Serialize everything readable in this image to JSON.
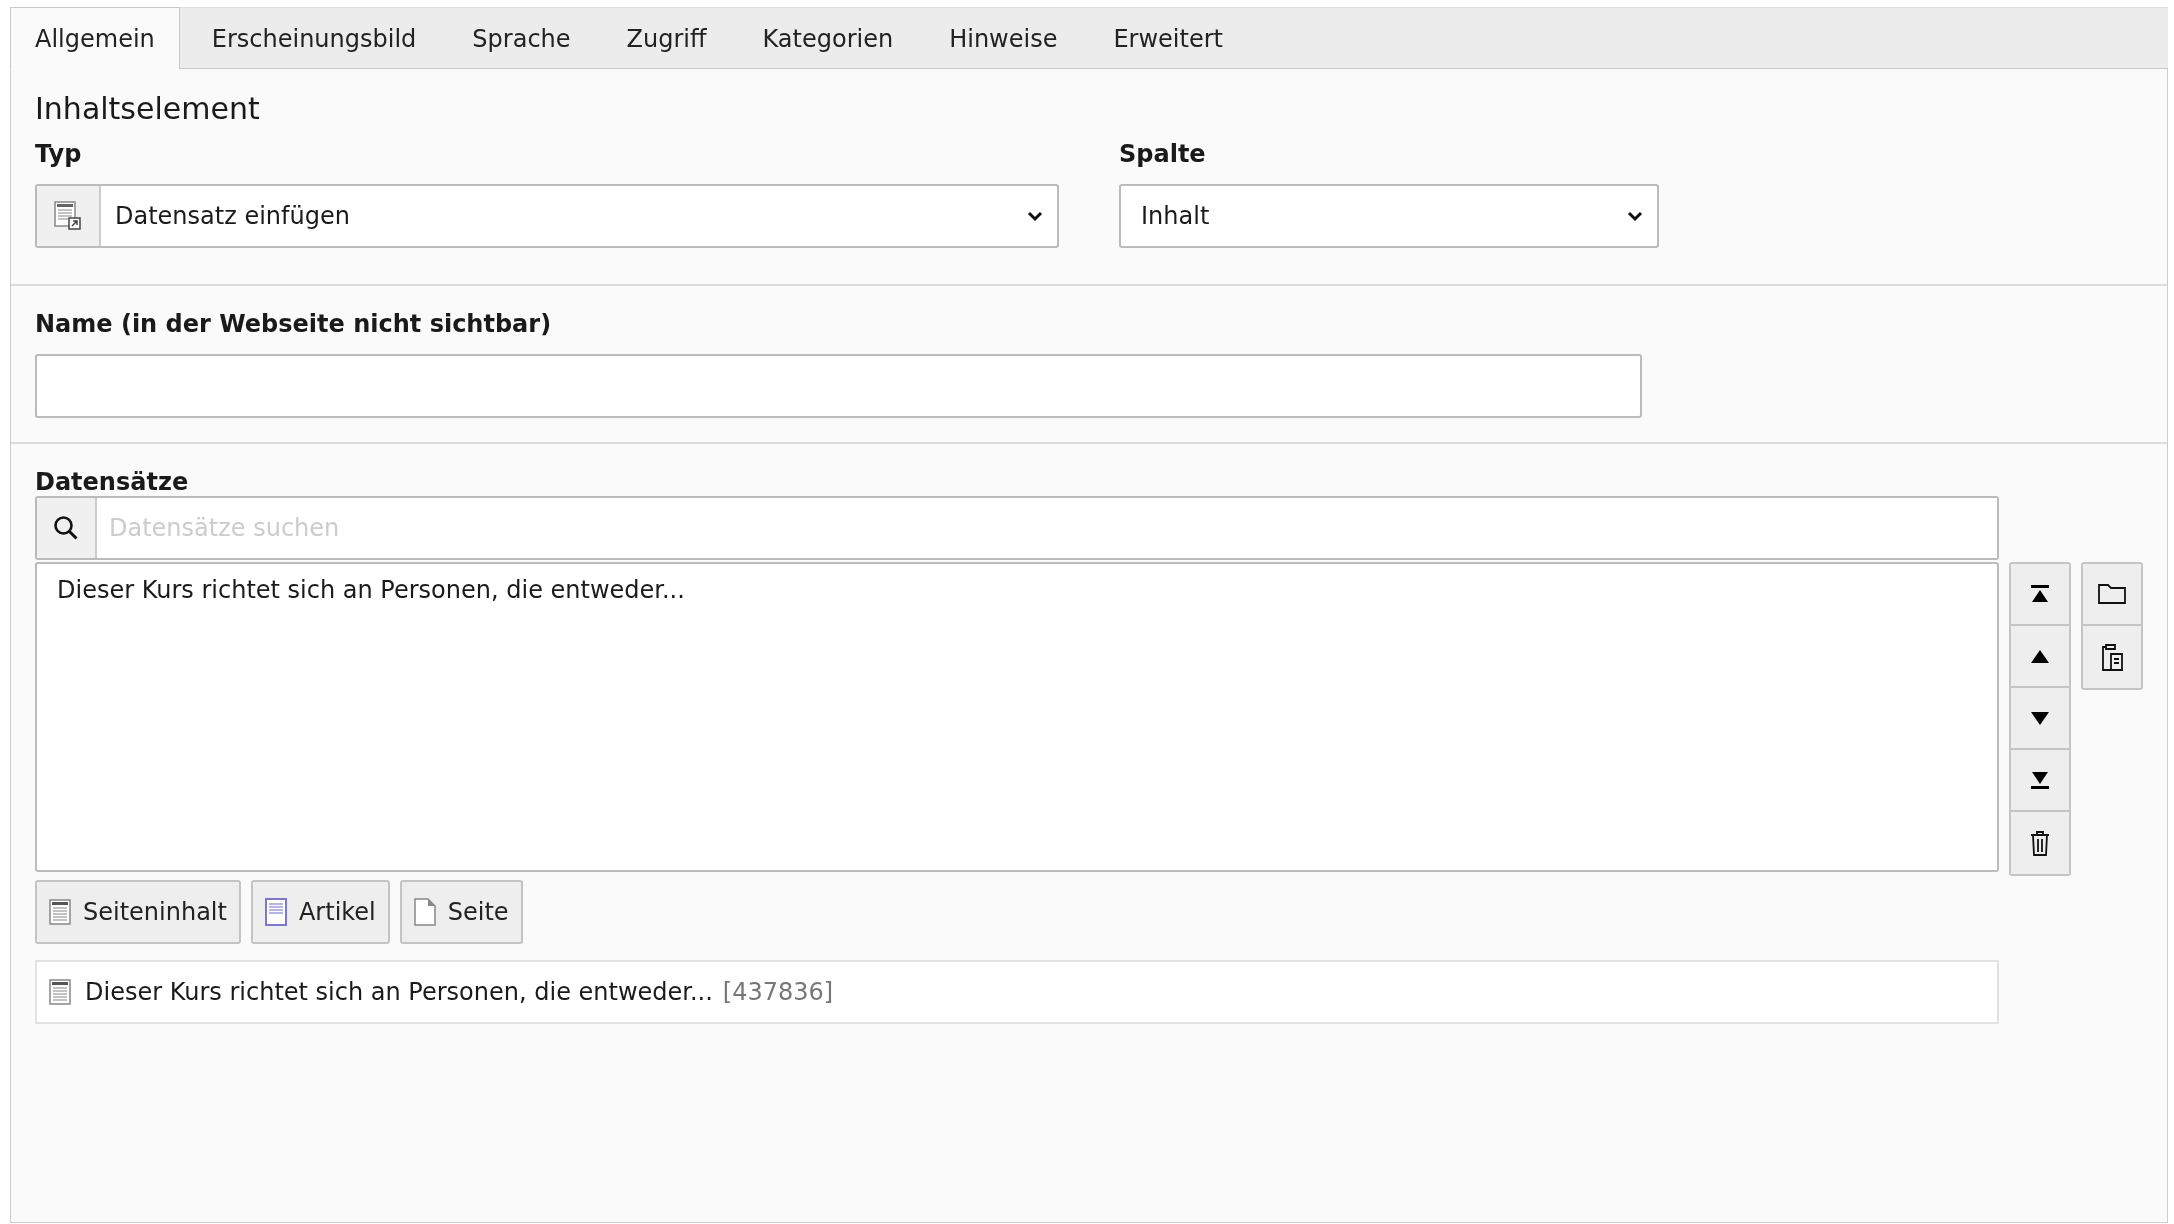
{
  "tabs": [
    {
      "label": "Allgemein",
      "selected": true
    },
    {
      "label": "Erscheinungsbild",
      "selected": false
    },
    {
      "label": "Sprache",
      "selected": false
    },
    {
      "label": "Zugriff",
      "selected": false
    },
    {
      "label": "Kategorien",
      "selected": false
    },
    {
      "label": "Hinweise",
      "selected": false
    },
    {
      "label": "Erweitert",
      "selected": false
    }
  ],
  "section_title": "Inhaltselement",
  "type_field": {
    "label": "Typ",
    "value": "Datensatz einfügen"
  },
  "column_field": {
    "label": "Spalte",
    "value": "Inhalt"
  },
  "name_field": {
    "label": "Name (in der Webseite nicht sichtbar)"
  },
  "records": {
    "label": "Datensätze",
    "search": {
      "placeholder": "Datensätze suchen"
    },
    "options": [
      "Dieser Kurs richtet sich an Personen, die entweder..."
    ],
    "add_buttons": [
      {
        "label": "Seiteninhalt",
        "kind": "content"
      },
      {
        "label": "Artikel",
        "kind": "article"
      },
      {
        "label": "Seite",
        "kind": "page"
      }
    ],
    "items": [
      {
        "title": "Dieser Kurs richtet sich an Personen, die entweder...",
        "uid": "[437836]"
      }
    ]
  }
}
